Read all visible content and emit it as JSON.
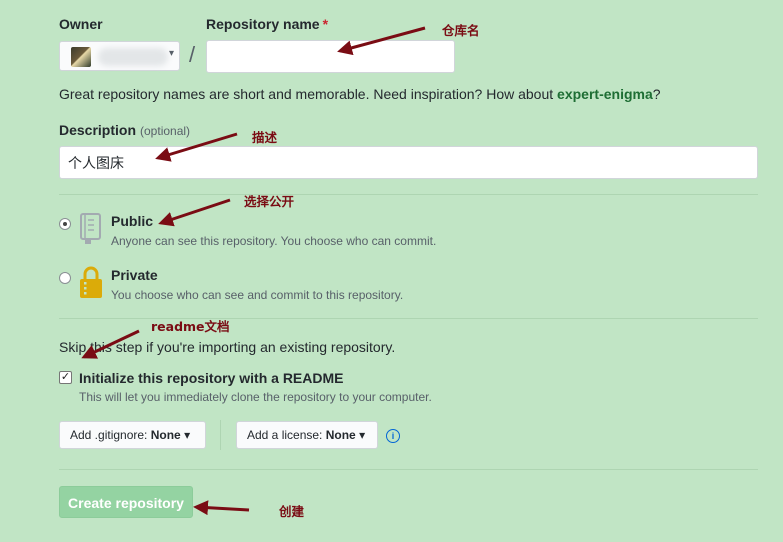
{
  "form": {
    "owner_label": "Owner",
    "repo_name_label": "Repository name",
    "required_mark": "*",
    "repo_name_value": "",
    "slash": "/",
    "hint_prefix": "Great repository names are short and memorable. Need inspiration? How about ",
    "hint_suggestion": "expert-enigma",
    "hint_suffix": "?",
    "description_label": "Description",
    "description_optional": "(optional)",
    "description_value": "个人图床",
    "public_title": "Public",
    "public_desc": "Anyone can see this repository. You choose who can commit.",
    "private_title": "Private",
    "private_desc": "You choose who can see and commit to this repository.",
    "skip_text": "Skip this step if you're importing an existing repository.",
    "init_readme_label": "Initialize this repository with a README",
    "init_readme_desc": "This will let you immediately clone the repository to your computer.",
    "gitignore_label": "Add .gitignore:",
    "gitignore_value": "None",
    "license_label": "Add a license:",
    "license_value": "None",
    "create_button": "Create repository",
    "visibility_selected": "public",
    "init_readme_checked": true
  },
  "annotations": {
    "repo_name": "仓库名",
    "description": "描述",
    "visibility": "选择公开",
    "readme": "readme文档",
    "create": "创建"
  },
  "colors": {
    "background": "#c1e5c5",
    "annotation": "#7a0c14",
    "create_button": "#94d3a2",
    "suggestion": "#1e6e34",
    "info": "#0366d6"
  },
  "icons": {
    "public": "repo-book-icon",
    "private": "lock-icon",
    "caret": "caret-down-icon",
    "info": "info-icon",
    "check": "check-icon"
  }
}
